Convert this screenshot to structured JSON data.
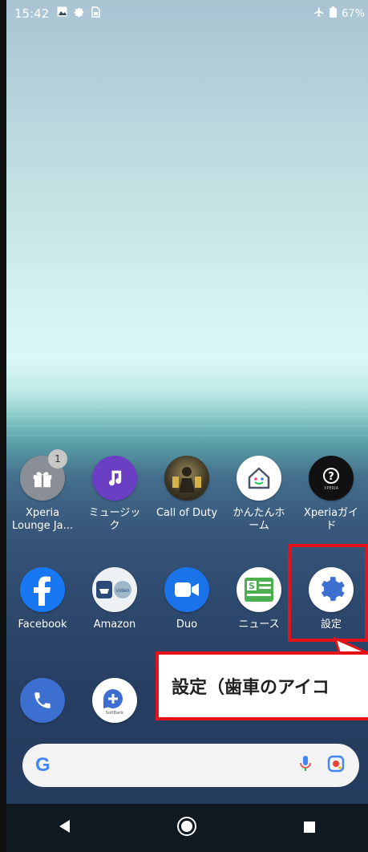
{
  "status_bar": {
    "time": "15:42",
    "battery": "67%",
    "icons": [
      "image-icon",
      "settings-icon",
      "sim-icon",
      "airplane-icon",
      "battery-icon"
    ]
  },
  "row1": [
    {
      "label": "Xperia\nLounge Ja...",
      "icon": "gift-icon",
      "badge": "1"
    },
    {
      "label": "ミュージッ\nク",
      "icon": "music-icon"
    },
    {
      "label": "Call of Duty",
      "icon": "game-icon"
    },
    {
      "label": "かんたんホ\nーム",
      "icon": "home-icon"
    },
    {
      "label": "Xperiaガイ\nド",
      "icon": "help-icon"
    }
  ],
  "row2": [
    {
      "label": "Facebook",
      "icon": "facebook-icon"
    },
    {
      "label": "Amazon",
      "icon": "amazon-icon"
    },
    {
      "label": "Duo",
      "icon": "video-icon"
    },
    {
      "label": "ニュース",
      "icon": "news-icon"
    },
    {
      "label": "設定",
      "icon": "gear-icon"
    }
  ],
  "dock": [
    {
      "icon": "phone-icon"
    },
    {
      "icon": "message-icon",
      "caption": "SoftBank"
    }
  ],
  "callout_text": "設定（歯車のアイコ",
  "search_bar": {
    "logo": "G"
  },
  "colors": {
    "highlight_red": "#e5121a",
    "facebook_blue": "#1877f2",
    "music_purple": "#6a3fc4",
    "duo_blue": "#1a73e8",
    "settings_blue": "#3d6fd1",
    "news_green": "#4caf50"
  }
}
